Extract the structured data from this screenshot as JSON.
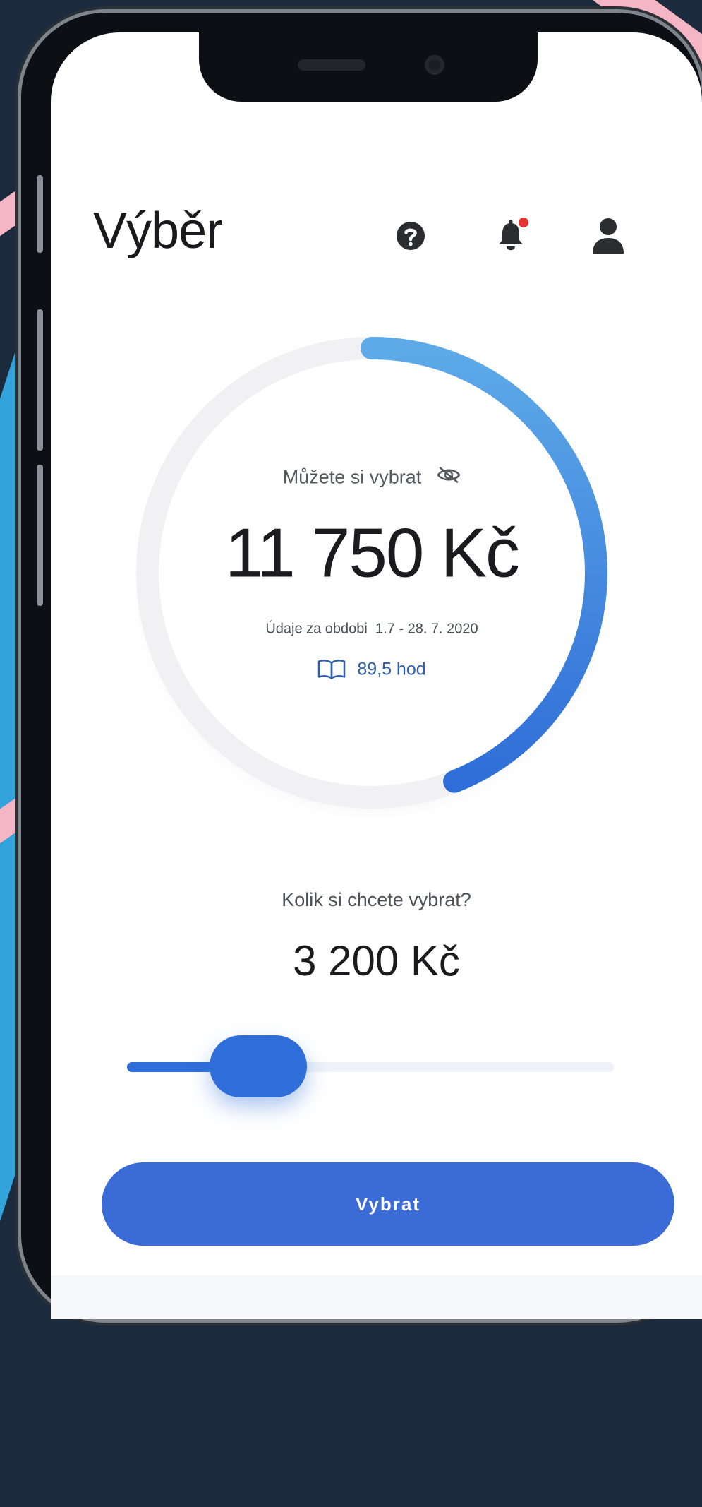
{
  "header": {
    "title": "Výběr"
  },
  "balance": {
    "label": "Můžete si vybrat",
    "amount": "11 750 Kč",
    "period_label": "Údaje za obdobi",
    "period_range": "1.7 - 28. 7. 2020",
    "hours": "89,5 hod",
    "progress_fraction": 0.44
  },
  "withdraw": {
    "question": "Kolik si chcete vybrat?",
    "amount": "3 200 Kč",
    "slider_fraction": 0.27,
    "button_label": "Vybrat"
  },
  "icons": {
    "help": "help-circle-icon",
    "notifications": "bell-icon",
    "profile": "user-icon",
    "hide_amount": "eye-off-icon",
    "hours": "book-icon"
  },
  "colors": {
    "accent": "#3a6bd6",
    "gauge_start": "#5eaae8",
    "gauge_end": "#2f6ed8",
    "notification_dot": "#e3342f"
  }
}
